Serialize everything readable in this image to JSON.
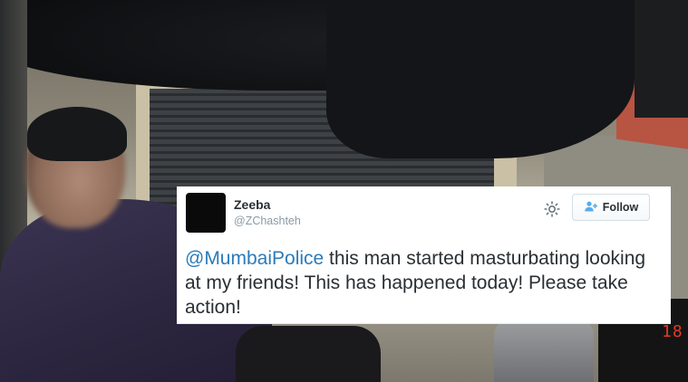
{
  "tweet": {
    "author_name": "Zeeba",
    "author_handle": "@ZChashteh",
    "follow_label": "Follow",
    "mention": "@MumbaiPolice",
    "text": " this man started masturbating looking at my friends! This has happened today! Please take action!"
  },
  "background": {
    "meter_reading": "18"
  },
  "colors": {
    "mention": "#2b7bb9",
    "text": "#292f33",
    "handle": "#8899a6",
    "meter": "#e03a2a"
  },
  "icons": {
    "settings": "gear-icon",
    "follow": "add-person-icon"
  }
}
